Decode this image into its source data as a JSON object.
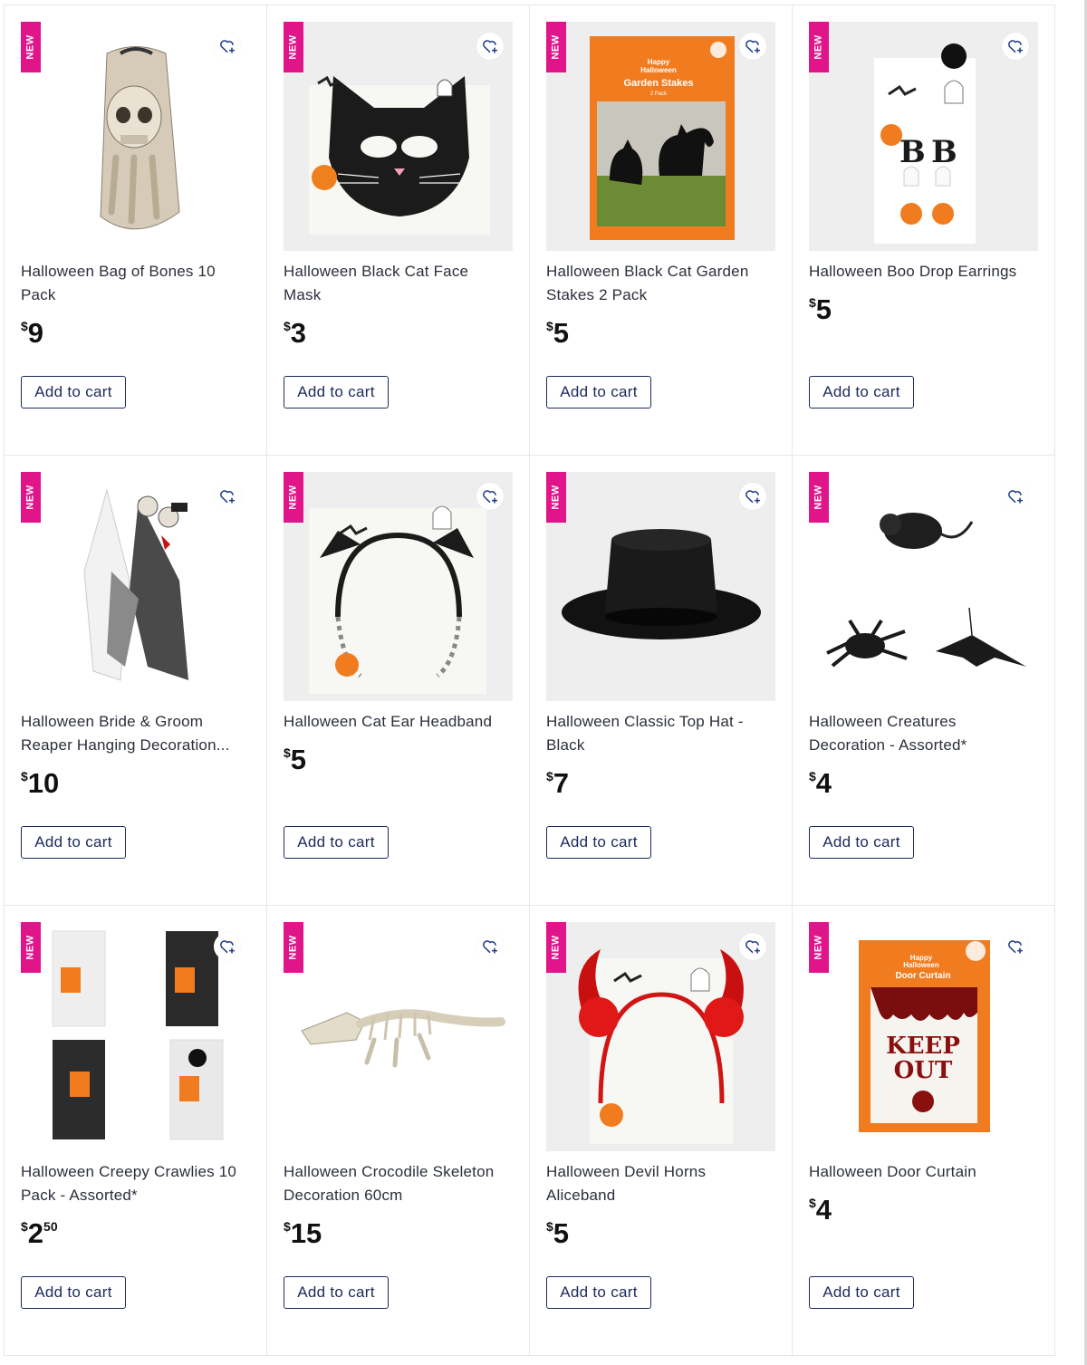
{
  "badge_label": "NEW",
  "favorite_icon": "heart-plus-icon",
  "accent_color": "#e0158a",
  "button_color": "#1c2a5c",
  "currency_symbol": "$",
  "products": [
    {
      "title": "Halloween Bag of Bones 10 Pack",
      "price_dollars": "9",
      "price_cents": "",
      "new": true,
      "cart_label": "Add to cart"
    },
    {
      "title": "Halloween Black Cat Face Mask",
      "price_dollars": "3",
      "price_cents": "",
      "new": true,
      "cart_label": "Add to cart"
    },
    {
      "title": "Halloween Black Cat Garden Stakes 2 Pack",
      "price_dollars": "5",
      "price_cents": "",
      "new": true,
      "cart_label": "Add to cart",
      "packaging": {
        "line1": "Happy",
        "line2": "Halloween",
        "line3": "Garden Stakes",
        "line4": "2 Pack"
      }
    },
    {
      "title": "Halloween Boo Drop Earrings",
      "price_dollars": "5",
      "price_cents": "",
      "new": true,
      "cart_label": "Add to cart"
    },
    {
      "title": "Halloween Bride & Groom Reaper Hanging Decoration...",
      "price_dollars": "10",
      "price_cents": "",
      "new": true,
      "cart_label": "Add to cart"
    },
    {
      "title": "Halloween Cat Ear Headband",
      "price_dollars": "5",
      "price_cents": "",
      "new": true,
      "cart_label": "Add to cart"
    },
    {
      "title": "Halloween Classic Top Hat - Black",
      "price_dollars": "7",
      "price_cents": "",
      "new": true,
      "cart_label": "Add to cart"
    },
    {
      "title": "Halloween Creatures Decoration - Assorted*",
      "price_dollars": "4",
      "price_cents": "",
      "new": true,
      "cart_label": "Add to cart"
    },
    {
      "title": "Halloween Creepy Crawlies 10 Pack - Assorted*",
      "price_dollars": "2",
      "price_cents": "50",
      "new": true,
      "cart_label": "Add to cart"
    },
    {
      "title": "Halloween Crocodile Skeleton Decoration 60cm",
      "price_dollars": "15",
      "price_cents": "",
      "new": true,
      "cart_label": "Add to cart"
    },
    {
      "title": "Halloween Devil Horns Aliceband",
      "price_dollars": "5",
      "price_cents": "",
      "new": true,
      "cart_label": "Add to cart"
    },
    {
      "title": "Halloween Door Curtain",
      "price_dollars": "4",
      "price_cents": "",
      "new": true,
      "cart_label": "Add to cart",
      "packaging": {
        "line1": "Happy",
        "line2": "Halloween",
        "line3": "Door Curtain",
        "line4": "KEEP",
        "line5": "OUT"
      }
    }
  ]
}
